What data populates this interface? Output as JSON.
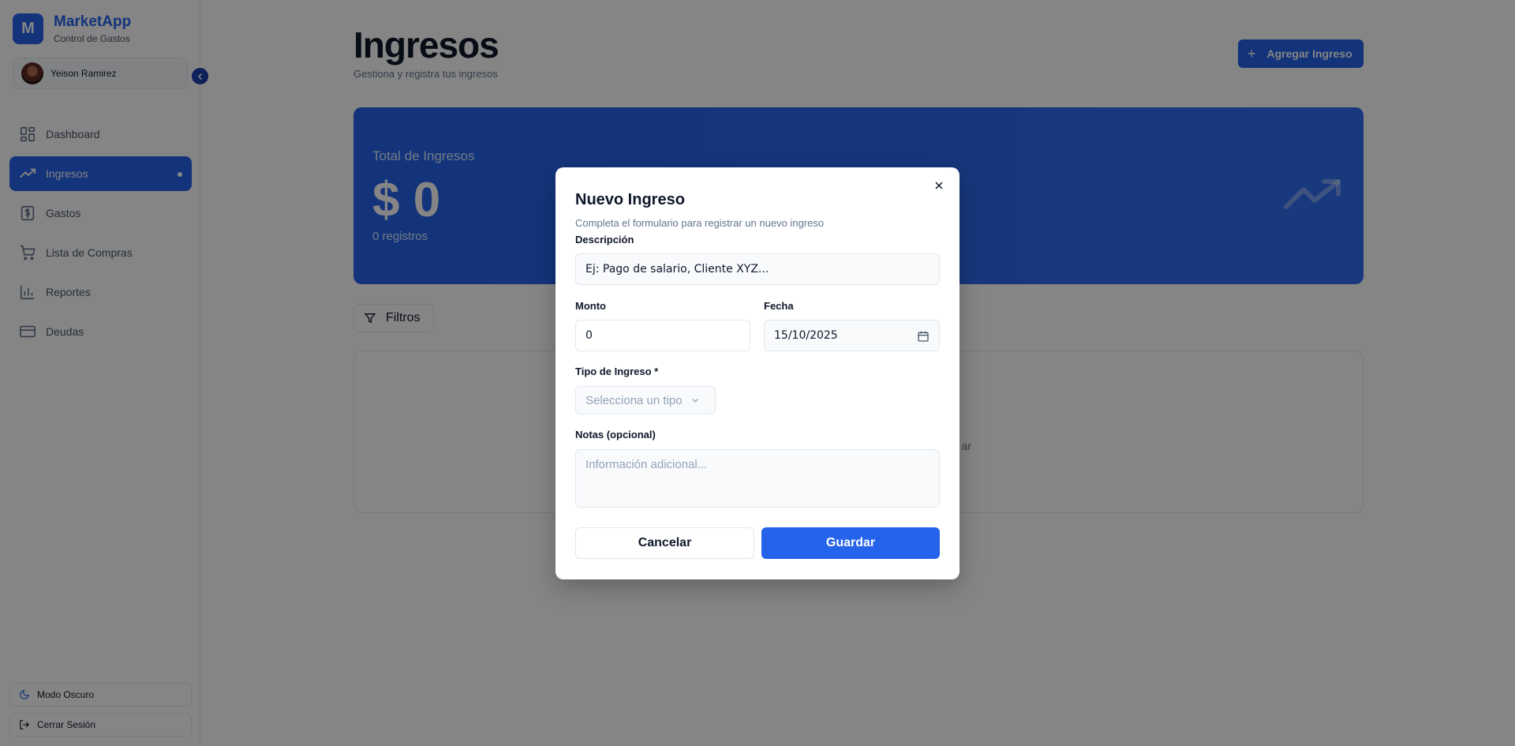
{
  "brand": {
    "logo_letter": "M",
    "name": "MarketApp",
    "subtitle": "Control de Gastos"
  },
  "user": {
    "name": "Yeison Ramirez"
  },
  "sidebar": {
    "items": [
      {
        "label": "Dashboard",
        "icon": "dashboard-icon"
      },
      {
        "label": "Ingresos",
        "icon": "trending-up-icon",
        "active": true
      },
      {
        "label": "Gastos",
        "icon": "dollar-icon"
      },
      {
        "label": "Lista de Compras",
        "icon": "cart-icon"
      },
      {
        "label": "Reportes",
        "icon": "bar-chart-icon"
      },
      {
        "label": "Deudas",
        "icon": "credit-card-icon"
      }
    ],
    "dark_mode_label": "Modo Oscuro",
    "logout_label": "Cerrar Sesión"
  },
  "main": {
    "title": "Ingresos",
    "subtitle": "Gestiona y registra tus ingresos",
    "add_button_label": "Agregar Ingreso",
    "total": {
      "label": "Total de Ingresos",
      "amount": "$ 0",
      "count": "0 registros"
    },
    "filters_label": "Filtros",
    "empty_text_fragment": "ar"
  },
  "modal": {
    "title": "Nuevo Ingreso",
    "subtitle": "Completa el formulario para registrar un nuevo ingreso",
    "description_label": "Descripción",
    "description_placeholder": "Ej: Pago de salario, Cliente XYZ...",
    "amount_label": "Monto",
    "amount_value": "0",
    "date_label": "Fecha",
    "date_value": "15/10/2025",
    "type_label": "Tipo de Ingreso *",
    "type_placeholder": "Selecciona un tipo",
    "notes_label": "Notas (opcional)",
    "notes_placeholder": "Información adicional...",
    "cancel_label": "Cancelar",
    "save_label": "Guardar"
  },
  "colors": {
    "primary": "#2563eb",
    "overlay": "rgba(0,0,0,0.48)"
  }
}
